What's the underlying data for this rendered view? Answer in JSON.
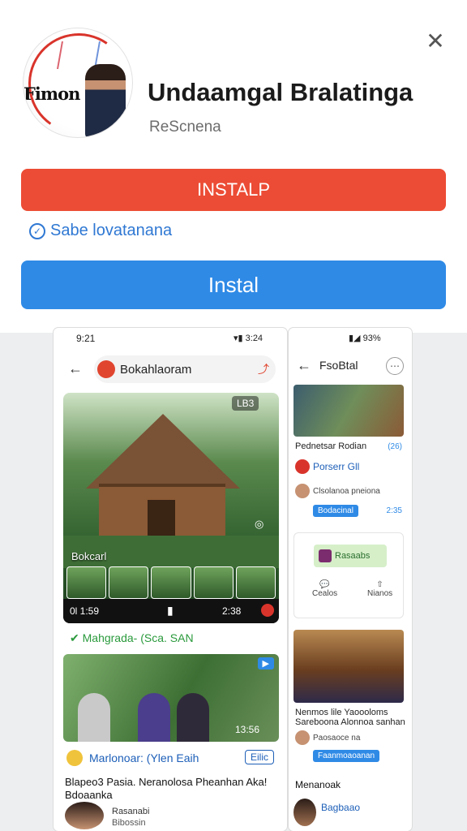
{
  "dialog": {
    "app_name": "Undaamgal Bralatinga",
    "publisher": "ReScnena",
    "logo_text": "Fimon",
    "primary_button": "INSTALP",
    "verified_text": "Sabe lovatanana",
    "install_button": "Instal"
  },
  "phone_left": {
    "time": "9:21",
    "signal": "3:24",
    "search_text": "Bokahlaoram",
    "hero_label": "Bokcarl",
    "hero_badge": "LB3",
    "player_left": "0l 1:59",
    "player_right": "2:38",
    "chip_text": "Mahgrada- (Sca. SAN",
    "second_badge": "",
    "second_count": "13:56",
    "channel_name": "Marlonoar: (Ylen Eaih",
    "channel_button": "Eilic",
    "caption": "Blapeo3 Pasia. Neranolosa Pheanhan Aka! Bdoaanka",
    "footer_line1": "Rasanabi",
    "footer_line2": "Bibossin"
  },
  "phone_right": {
    "battery": "93%",
    "title": "FsoBtal",
    "line1": "Pednetsar Rodian",
    "line1_num": "(26)",
    "link1": "Porserr Gll",
    "sub1": "Clsolanoa pneiona",
    "btn1": "Bodacinal",
    "num1": "2:35",
    "card_label": "Rasaabs",
    "card_action1": "Cealos",
    "card_action2": "Nianos",
    "line2": "Nenmos lile Yaoooloms",
    "line3": "Sareboona Alonnoa sanhan",
    "sub2": "Paosaoce na",
    "btn2": "Faanmoaoanan",
    "heading": "Menanoak",
    "bottom_link": "Bagbaao"
  }
}
